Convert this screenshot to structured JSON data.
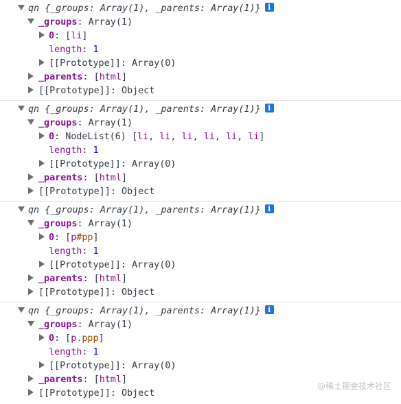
{
  "entries": [
    {
      "summary": {
        "name": "qn",
        "open_brace": "{",
        "groups_key": "_groups",
        "groups_val": "Array(1)",
        "sep": ", ",
        "parents_key": "_parents",
        "parents_val": "Array(1)",
        "close_brace": "}"
      },
      "groups_label": "_groups",
      "groups_type": "Array(1)",
      "item0_key": "0",
      "item0_prefix": "",
      "item0_value": "li",
      "item0_class": "",
      "length_label": "length",
      "length_value": "1",
      "array_proto_label": "[[Prototype]]",
      "array_proto_value": "Array(0)",
      "parents_label": "_parents",
      "parents_value": "html",
      "obj_proto_label": "[[Prototype]]",
      "obj_proto_value": "Object"
    },
    {
      "summary": {
        "name": "qn",
        "open_brace": "{",
        "groups_key": "_groups",
        "groups_val": "Array(1)",
        "sep": ", ",
        "parents_key": "_parents",
        "parents_val": "Array(1)",
        "close_brace": "}"
      },
      "groups_label": "_groups",
      "groups_type": "Array(1)",
      "item0_key": "0",
      "item0_prefix": "NodeList(6) ",
      "item0_list": [
        "li",
        "li",
        "li",
        "li",
        "li",
        "li"
      ],
      "length_label": "length",
      "length_value": "1",
      "array_proto_label": "[[Prototype]]",
      "array_proto_value": "Array(0)",
      "parents_label": "_parents",
      "parents_value": "html",
      "obj_proto_label": "[[Prototype]]",
      "obj_proto_value": "Object"
    },
    {
      "summary": {
        "name": "qn",
        "open_brace": "{",
        "groups_key": "_groups",
        "groups_val": "Array(1)",
        "sep": ", ",
        "parents_key": "_parents",
        "parents_val": "Array(1)",
        "close_brace": "}"
      },
      "groups_label": "_groups",
      "groups_type": "Array(1)",
      "item0_key": "0",
      "item0_prefix": "",
      "item0_value": "p",
      "item0_id": "#pp",
      "length_label": "length",
      "length_value": "1",
      "array_proto_label": "[[Prototype]]",
      "array_proto_value": "Array(0)",
      "parents_label": "_parents",
      "parents_value": "html",
      "obj_proto_label": "[[Prototype]]",
      "obj_proto_value": "Object"
    },
    {
      "summary": {
        "name": "qn",
        "open_brace": "{",
        "groups_key": "_groups",
        "groups_val": "Array(1)",
        "sep": ", ",
        "parents_key": "_parents",
        "parents_val": "Array(1)",
        "close_brace": "}"
      },
      "groups_label": "_groups",
      "groups_type": "Array(1)",
      "item0_key": "0",
      "item0_prefix": "",
      "item0_value": "p",
      "item0_cls": ".ppp",
      "length_label": "length",
      "length_value": "1",
      "array_proto_label": "[[Prototype]]",
      "array_proto_value": "Array(0)",
      "parents_label": "_parents",
      "parents_value": "html",
      "obj_proto_label": "[[Prototype]]",
      "obj_proto_value": "Object"
    }
  ],
  "info_icon_glyph": "i",
  "watermark": "@稀土掘金技术社区",
  "colors": {
    "key": "#881391",
    "number": "#1c00cf",
    "element": "#881280",
    "class": "#994500",
    "info": "#1a73e8"
  }
}
